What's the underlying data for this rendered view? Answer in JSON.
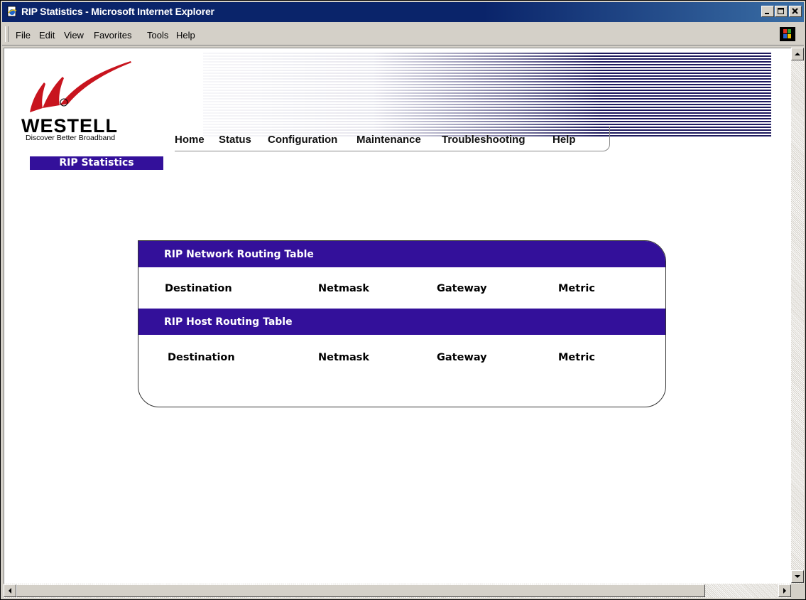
{
  "window": {
    "title": "RIP Statistics - Microsoft Internet Explorer"
  },
  "menubar": {
    "items": [
      {
        "label": "File"
      },
      {
        "label": "Edit"
      },
      {
        "label": "View"
      },
      {
        "label": "Favorites"
      },
      {
        "label": "Tools"
      },
      {
        "label": "Help"
      }
    ]
  },
  "header": {
    "brand": "WESTELL",
    "tagline": "Discover Better Broadband",
    "logo_color": "#c8141e",
    "accent_color": "#33109a"
  },
  "nav": {
    "items": [
      {
        "label": "Home"
      },
      {
        "label": "Status"
      },
      {
        "label": "Configuration"
      },
      {
        "label": "Maintenance"
      },
      {
        "label": "Troubleshooting"
      },
      {
        "label": "Help"
      }
    ]
  },
  "page": {
    "label": "RIP Statistics"
  },
  "tables": [
    {
      "title": "RIP Network Routing Table",
      "columns": [
        "Destination",
        "Netmask",
        "Gateway",
        "Metric"
      ]
    },
    {
      "title": "RIP Host Routing Table",
      "columns": [
        "Destination",
        "Netmask",
        "Gateway",
        "Metric"
      ]
    }
  ]
}
